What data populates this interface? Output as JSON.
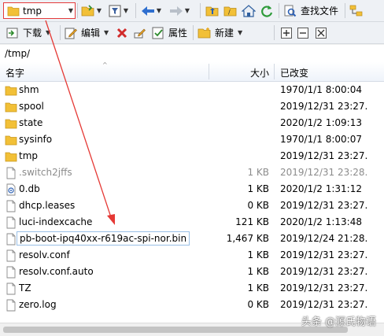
{
  "toolbar1": {
    "location_value": "tmp",
    "search_label": "查找文件"
  },
  "toolbar2": {
    "download_label": "下载",
    "edit_label": "编辑",
    "properties_label": "属性",
    "new_label": "新建"
  },
  "path": "/tmp/",
  "columns": {
    "name": "名字",
    "size": "大小",
    "modified": "已改变"
  },
  "files": [
    {
      "name": "shm",
      "size": "",
      "modified": "1970/1/1 8:00:04",
      "kind": "folder"
    },
    {
      "name": "spool",
      "size": "",
      "modified": "2019/12/31 23:27...",
      "kind": "folder"
    },
    {
      "name": "state",
      "size": "",
      "modified": "2020/1/2 1:09:13",
      "kind": "folder"
    },
    {
      "name": "sysinfo",
      "size": "",
      "modified": "1970/1/1 8:00:07",
      "kind": "folder"
    },
    {
      "name": "tmp",
      "size": "",
      "modified": "2019/12/31 23:27...",
      "kind": "folder"
    },
    {
      "name": ".switch2jffs",
      "size": "1 KB",
      "modified": "2019/12/31 23:28...",
      "kind": "file-hidden"
    },
    {
      "name": "0.db",
      "size": "1 KB",
      "modified": "2020/1/2 1:31:12",
      "kind": "db"
    },
    {
      "name": "dhcp.leases",
      "size": "0 KB",
      "modified": "2019/12/31 23:27...",
      "kind": "file"
    },
    {
      "name": "luci-indexcache",
      "size": "121 KB",
      "modified": "2020/1/2 1:13:48",
      "kind": "file"
    },
    {
      "name": "pb-boot-ipq40xx-r619ac-spi-nor.bin",
      "size": "1,467 KB",
      "modified": "2019/12/24 21:28...",
      "kind": "file-selected"
    },
    {
      "name": "resolv.conf",
      "size": "1 KB",
      "modified": "2019/12/31 23:27...",
      "kind": "file"
    },
    {
      "name": "resolv.conf.auto",
      "size": "1 KB",
      "modified": "2019/12/31 23:27...",
      "kind": "file"
    },
    {
      "name": "TZ",
      "size": "1 KB",
      "modified": "2019/12/31 23:27...",
      "kind": "file"
    },
    {
      "name": "zero.log",
      "size": "0 KB",
      "modified": "2019/12/31 23:27...",
      "kind": "file"
    }
  ],
  "watermark": "头条 @源氏物语",
  "colors": {
    "annotation_red": "#e53935",
    "folder_yellow": "#f2c037",
    "selection_border": "#99bfe6"
  }
}
